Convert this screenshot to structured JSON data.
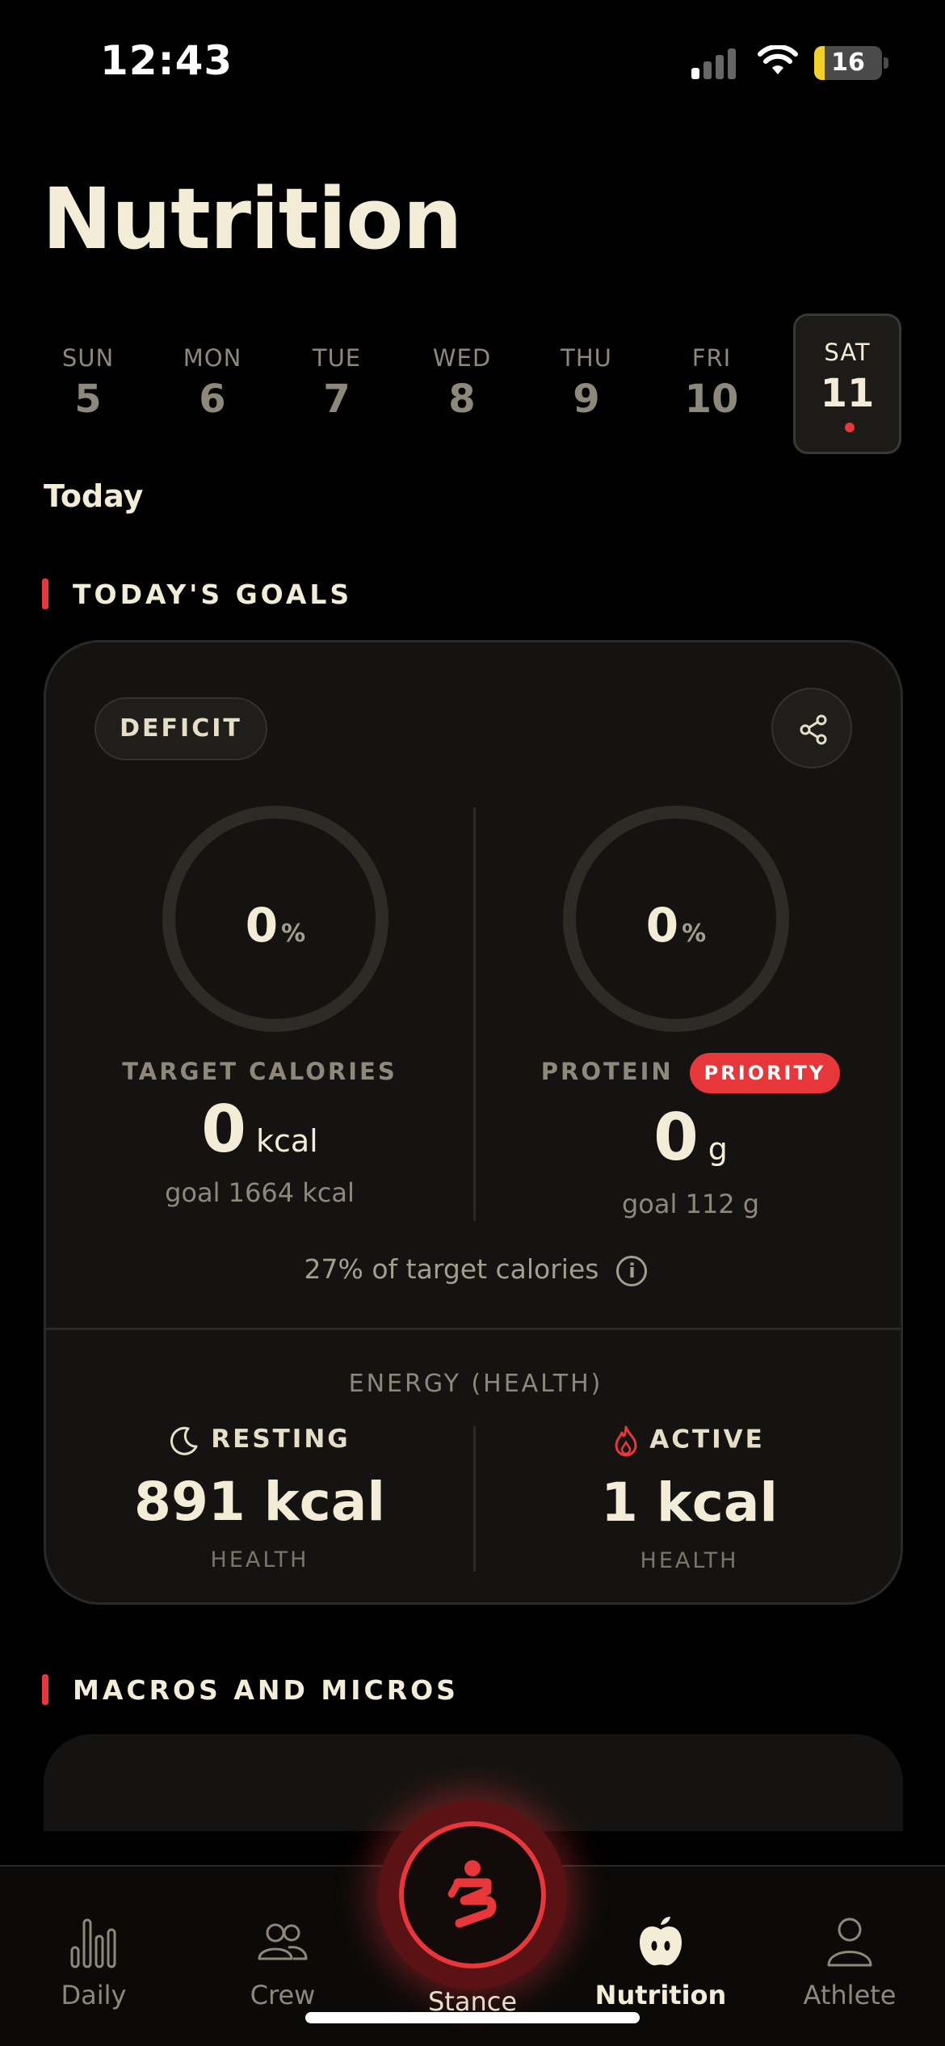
{
  "status": {
    "time": "12:43",
    "battery": "16"
  },
  "title": "Nutrition",
  "week": [
    {
      "name": "SUN",
      "num": "5"
    },
    {
      "name": "MON",
      "num": "6"
    },
    {
      "name": "TUE",
      "num": "7"
    },
    {
      "name": "WED",
      "num": "8"
    },
    {
      "name": "THU",
      "num": "9"
    },
    {
      "name": "FRI",
      "num": "10"
    },
    {
      "name": "SAT",
      "num": "11",
      "selected": true
    }
  ],
  "today_label": "Today",
  "goals": {
    "section_title": "TODAY'S GOALS",
    "mode_pill": "DEFICIT",
    "calories": {
      "percent": "0",
      "percent_unit": "%",
      "label": "TARGET CALORIES",
      "value": "0",
      "unit": "kcal",
      "goal": "goal 1664 kcal"
    },
    "protein": {
      "percent": "0",
      "percent_unit": "%",
      "label": "PROTEIN",
      "badge": "PRIORITY",
      "value": "0",
      "unit": "g",
      "goal": "goal 112 g"
    },
    "target_note": "27% of target calories",
    "info_glyph": "i",
    "energy": {
      "title": "ENERGY (HEALTH)",
      "resting": {
        "label": "RESTING",
        "value": "891 kcal",
        "source": "HEALTH"
      },
      "active": {
        "label": "ACTIVE",
        "value": "1 kcal",
        "source": "HEALTH"
      }
    }
  },
  "macros": {
    "section_title": "MACROS AND MICROS"
  },
  "tabs": {
    "daily": "Daily",
    "crew": "Crew",
    "stance": "Stance",
    "nutrition": "Nutrition",
    "athlete": "Athlete"
  },
  "colors": {
    "accent": "#e8373b",
    "text": "#f3ecd6",
    "muted": "#8e887a",
    "card": "#141311"
  }
}
